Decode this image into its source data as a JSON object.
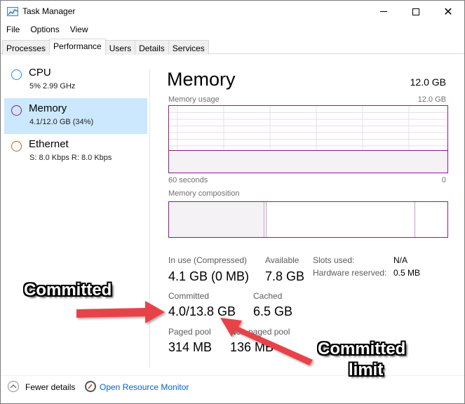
{
  "window": {
    "title": "Task Manager",
    "controls": {
      "minimize": "—",
      "maximize": "☐",
      "close": "✕"
    }
  },
  "menu": [
    "File",
    "Options",
    "View"
  ],
  "tabs": [
    {
      "label": "Processes"
    },
    {
      "label": "Performance",
      "active": true
    },
    {
      "label": "Users"
    },
    {
      "label": "Details"
    },
    {
      "label": "Services"
    }
  ],
  "sidebar": {
    "items": [
      {
        "name": "CPU",
        "sub": "5%  2.99 GHz",
        "color": "#1a8fd8"
      },
      {
        "name": "Memory",
        "sub": "4.1/12.0 GB (34%)",
        "color": "#8b1a8b",
        "selected": true
      },
      {
        "name": "Ethernet",
        "sub": "S: 8.0 Kbps  R: 8.0 Kbps",
        "color": "#c95d16"
      }
    ]
  },
  "main": {
    "title": "Memory",
    "total": "12.0 GB",
    "usage_label": "Memory usage",
    "usage_max": "12.0 GB",
    "time_left": "60 seconds",
    "time_right": "0",
    "composition_label": "Memory composition",
    "stats": {
      "in_use_label": "In use (Compressed)",
      "in_use_value": "4.1 GB (0 MB)",
      "available_label": "Available",
      "available_value": "7.8 GB",
      "committed_label": "Committed",
      "committed_value": "4.0/13.8 GB",
      "cached_label": "Cached",
      "cached_value": "6.5 GB",
      "paged_label": "Paged pool",
      "paged_value": "314 MB",
      "nonpaged_label": "Non-paged pool",
      "nonpaged_value": "136 MB",
      "slots_label": "Slots used:",
      "slots_value": "N/A",
      "hw_label": "Hardware reserved:",
      "hw_value": "0.5 MB"
    }
  },
  "footer": {
    "fewer_details": "Fewer details",
    "open_monitor": "Open Resource Monitor"
  },
  "annotations": {
    "committed": "Committed",
    "limit_line1": "Committed",
    "limit_line2": "limit"
  },
  "colors": {
    "memory_accent": "#8b1a8b",
    "selected_bg": "#cce8ff",
    "arrow": "#e8434a",
    "link": "#0066cc"
  }
}
